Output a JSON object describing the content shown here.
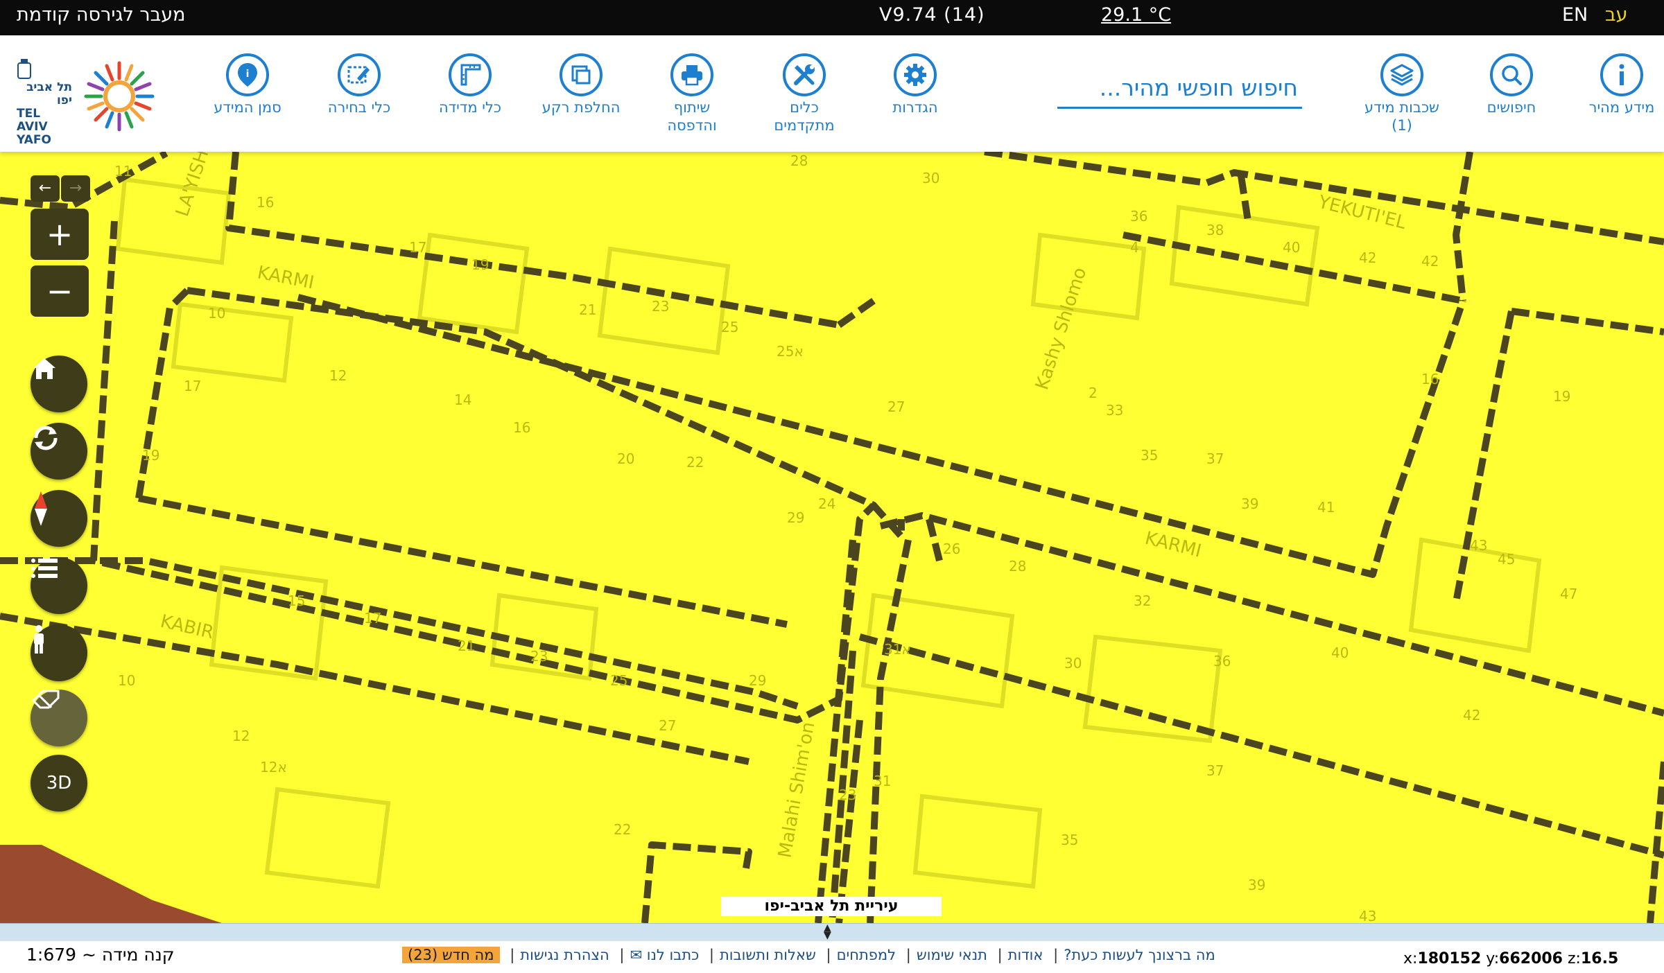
{
  "topbar": {
    "prev_version": "מעבר לגירסה קודמת",
    "version": "V9.74 (14)",
    "temperature": "29.1 °C",
    "lang_en": "EN",
    "lang_he": "עב"
  },
  "logo": {
    "text_en": "TEL AVIV YAFO",
    "text_he": "תל אביב יפו"
  },
  "toolbar": {
    "quick_info": "מידע מהיר",
    "searches": "חיפושים",
    "info_layers_line1": "שכבות מידע",
    "info_layers_count": "(1)",
    "search_placeholder": "חיפוש חופשי מהיר...",
    "settings": "הגדרות",
    "advanced_tools_line1": "כלים",
    "advanced_tools_line2": "מתקדמים",
    "share_print_line1": "שיתוף",
    "share_print_line2": "והדפסה",
    "change_background": "החלפת רקע",
    "measure_tools": "כלי מדידה",
    "select_tools": "כלי בחירה",
    "info_marker": "סמן המידע"
  },
  "map": {
    "background_color": "#ffff33",
    "parcel_line_color": "#4b4620",
    "label_color": "#b9b90f",
    "city_label": "עיריית תל אביב-יפו",
    "street_labels": [
      "LA'YISH",
      "KARMI",
      "KABIR",
      "YEKUTI'EL",
      "Kashy Shlomo",
      "KARMI",
      "Malahi Shim'on"
    ],
    "house_numbers": [
      "11",
      "16",
      "17",
      "19",
      "10",
      "12",
      "14",
      "16",
      "17",
      "19",
      "20",
      "21",
      "22",
      "23",
      "25",
      "25א",
      "26",
      "28",
      "30",
      "36",
      "38",
      "4",
      "40",
      "42",
      "42",
      "2",
      "33",
      "35",
      "37",
      "27",
      "39",
      "41",
      "43",
      "45",
      "47",
      "19",
      "16",
      "24",
      "29",
      "28",
      "32",
      "36",
      "30",
      "40",
      "42",
      "37",
      "35",
      "39",
      "43",
      "31",
      "31א",
      "15",
      "17",
      "21",
      "23",
      "25",
      "29",
      "27",
      "12",
      "10",
      "12א",
      "22",
      "23"
    ]
  },
  "controls": {
    "nav_back": "←",
    "nav_forward": "→",
    "zoom_in": "+",
    "zoom_out": "−",
    "three_d": "3D"
  },
  "bottombar": {
    "scale": "קנה מידה ~ 1:679",
    "links": [
      "מה ברצונך לעשות כעת?",
      "אודות",
      "תנאי שימוש",
      "למפתחים",
      "שאלות ותשובות",
      "כתבו לנו ✉",
      "הצהרת נגישות"
    ],
    "whats_new": "מה חדש (23)",
    "coord_x_label": "x:",
    "coord_x": "180152",
    "coord_y_label": "y:",
    "coord_y": "662006",
    "coord_z_label": "z:",
    "coord_z": "16.5"
  }
}
